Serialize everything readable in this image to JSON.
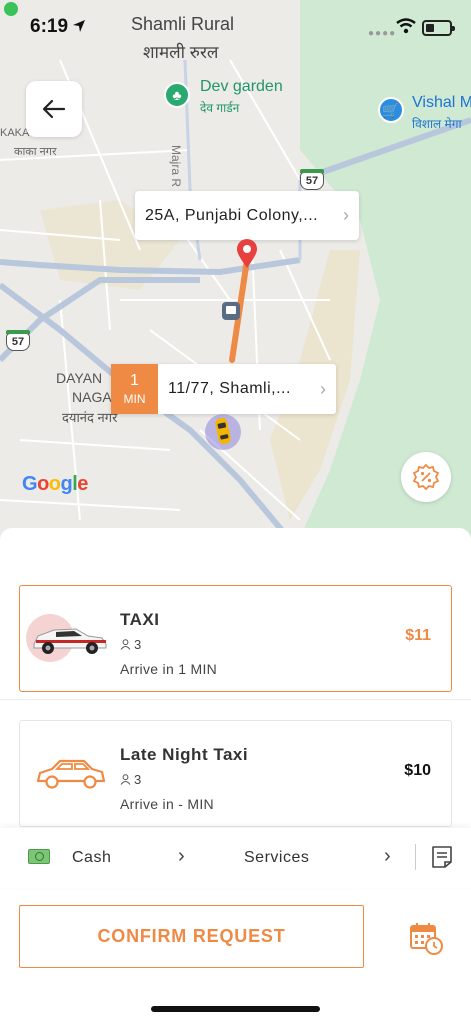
{
  "status_bar": {
    "time": "6:19"
  },
  "map": {
    "labels": {
      "area_en": "Shamli Rural",
      "area_hi": "शामली रुरल",
      "poi_dev_en": "Dev garden",
      "poi_dev_hi": "देव गार्डन",
      "poi_vishal_en": "Vishal M",
      "poi_vishal_hi": "विशाल मेगा",
      "kaka_en": "KAKA NAGAR",
      "kaka_hi": "काका नगर",
      "majra": "Majra R",
      "dayan_line1": "DAYAN",
      "dayan_line2": "NAGA",
      "dayan_hi": "दयानंद नगर"
    },
    "road_badge": "57",
    "google": [
      "G",
      "o",
      "o",
      "g",
      "l",
      "e"
    ],
    "google_colors": [
      "#4285F4",
      "#EA4335",
      "#FBBC05",
      "#4285F4",
      "#34A853",
      "#EA4335"
    ]
  },
  "route": {
    "destination": {
      "address": "25A, Punjabi Colony,..."
    },
    "pickup": {
      "eta_value": "1",
      "eta_unit": "MIN",
      "address": "11/77, Shamli,..."
    }
  },
  "rides": [
    {
      "name": "TAXI",
      "seats": "3",
      "arrive": "Arrive in 1 MIN",
      "price": "$11",
      "selected": true
    },
    {
      "name": "Late Night Taxi",
      "seats": "3",
      "arrive": "Arrive in - MIN",
      "price": "$10",
      "selected": false
    }
  ],
  "payment": {
    "method": "Cash",
    "services": "Services"
  },
  "actions": {
    "confirm": "CONFIRM REQUEST"
  },
  "colors": {
    "accent": "#ef8a45",
    "route": "#ef8a45",
    "pin": "#e8403d"
  },
  "icons": [
    "status-location-icon",
    "wifi-icon",
    "battery-icon",
    "back-arrow-icon",
    "destination-pin-icon",
    "car-marker-icon",
    "promo-percent-icon",
    "cash-icon",
    "chevron-right-icon",
    "notes-icon",
    "schedule-calendar-icon",
    "person-icon"
  ]
}
